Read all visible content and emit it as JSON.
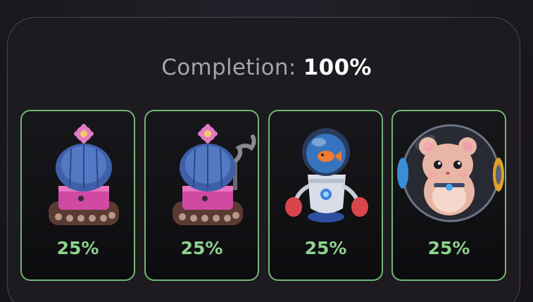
{
  "completion": {
    "label": "Completion:",
    "value": "100%"
  },
  "cards": [
    {
      "name": "cactus-tank",
      "percent": "25%",
      "icon": "cactus-tank-icon"
    },
    {
      "name": "cactus-tank-smoking",
      "percent": "25%",
      "icon": "cactus-tank-smoke-icon"
    },
    {
      "name": "fishbowl-robot",
      "percent": "25%",
      "icon": "robot-fish-icon"
    },
    {
      "name": "hamster-ball",
      "percent": "25%",
      "icon": "hamster-ball-icon"
    }
  ],
  "colors": {
    "accent_green": "#8ed38f",
    "card_border": "#6fb873",
    "background": "#1d1a20"
  }
}
